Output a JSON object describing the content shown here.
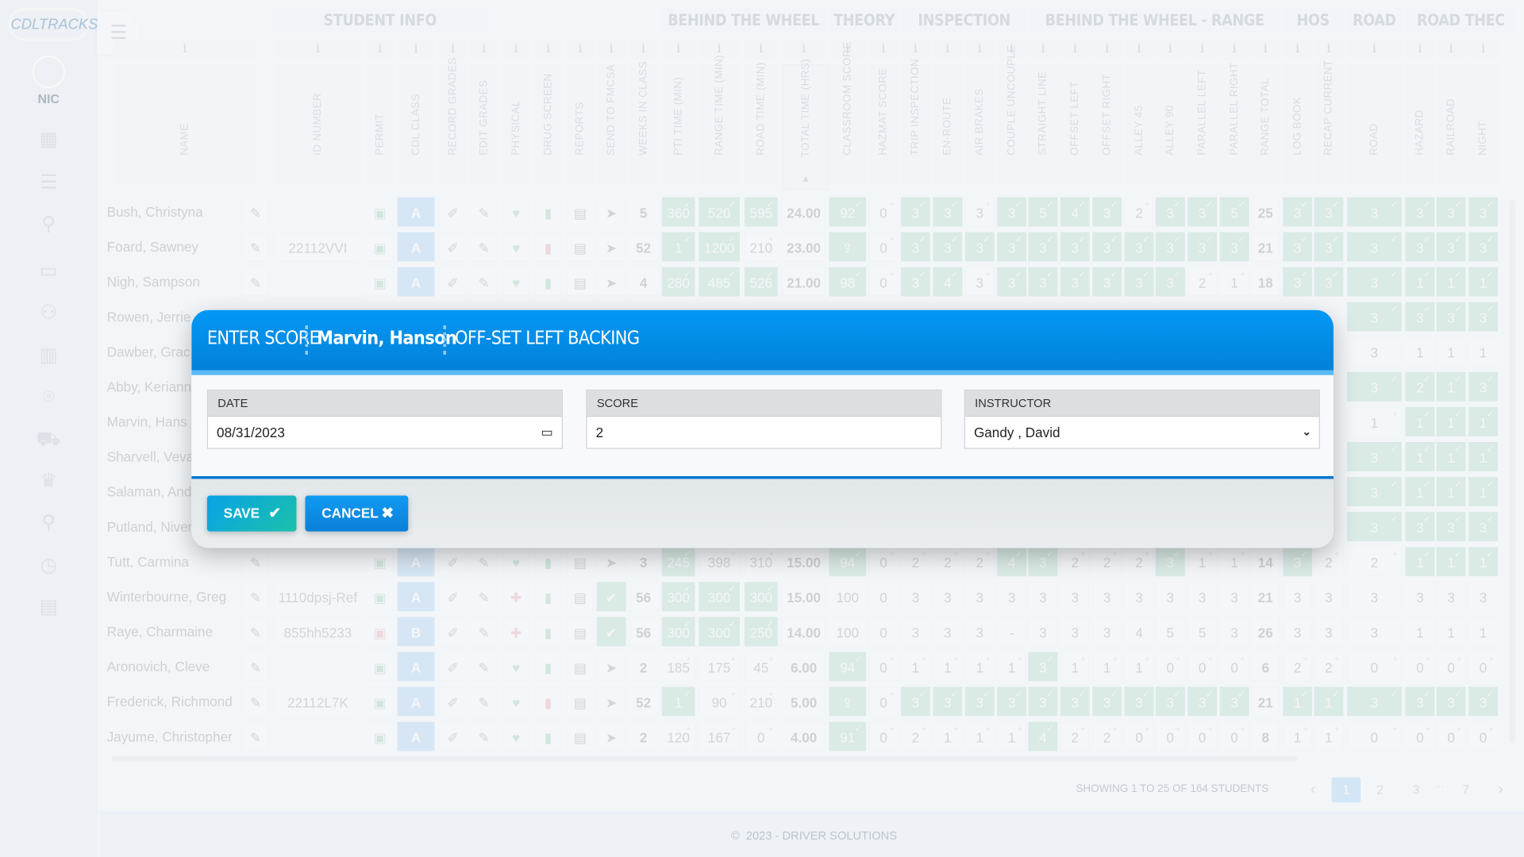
{
  "sidebar": {
    "logo": "CDLTRACKS",
    "user": "NIC",
    "icons": [
      "dashboard-grid-icon",
      "checklist-icon",
      "user-search-icon",
      "classroom-icon",
      "users-icon",
      "chart-icon",
      "location-icon",
      "truck-icon",
      "crown-icon",
      "instructor-icon",
      "clock-icon",
      "clipboard-icon"
    ]
  },
  "header": {
    "groups": [
      "STUDENT INFO",
      "BEHIND THE WHEEL",
      "THEORY",
      "INSPECTION",
      "BEHIND THE WHEEL - RANGE",
      "HOS",
      "ROAD",
      "ROAD THEC"
    ],
    "info_glyph": "i",
    "columns": [
      "NAME",
      "ID NUMBER",
      "PERMIT",
      "CDL CLASS",
      "RECORD GRADES",
      "EDIT GRADES",
      "PHYSICAL",
      "DRUG SCREEN",
      "REPORTS",
      "SEND TO FMCSA",
      "WEEKS IN CLASS",
      "PTI TIME (MIN)",
      "RANGE TIME (MIN)",
      "ROAD TIME (MIN)",
      "TOTAL TIME (HRS)",
      "CLASSROOM SCORE",
      "HAZMAT SCORE",
      "TRIP INSPECTION",
      "EN-ROUTE",
      "AIR BRAKES",
      "COUPLE UNCOUPLE",
      "STRAIGHT LINE",
      "OFFSET LEFT",
      "OFFSET RIGHT",
      "ALLEY 45",
      "ALLEY 90",
      "PARALLEL LEFT",
      "PARALLEL RIGHT",
      "RANGE TOTAL",
      "LOG BOOK",
      "RECAP CURRENT",
      "ROAD",
      "HAZARD",
      "RAILROAD",
      "NIGHT"
    ],
    "sort_indicator": "▲"
  },
  "rows": [
    {
      "name": "Bush, Christyna",
      "id": "",
      "cls": "A",
      "fmcsa": "send",
      "weeks": "5",
      "drug": "ok",
      "times": [
        "360✓",
        "520✓",
        "595✓"
      ],
      "total": "24.00",
      "classroom": "92✓",
      "hazmat": "0+",
      "scores": [
        "3✓",
        "3✓",
        "3+",
        "3✓",
        "5✓",
        "4✓",
        "3✓",
        "2+",
        "3✓",
        "3✓",
        "5✓"
      ],
      "range_total": "25",
      "road": [
        "3✓",
        "3✓",
        "3✓",
        "3✓",
        "3✓",
        "3✓"
      ]
    },
    {
      "name": "Foard, Sawney",
      "id": "22112VVI",
      "cls": "A",
      "fmcsa": "send",
      "weeks": "52",
      "drug": "fail",
      "times": [
        "1✓",
        "1200✓",
        "210+"
      ],
      "total": "23.00",
      "classroom": "upload",
      "hazmat": "0+",
      "scores": [
        "3✓",
        "3✓",
        "3✓",
        "3✓",
        "3✓",
        "3✓",
        "3✓",
        "3✓",
        "3✓",
        "3✓",
        "3✓"
      ],
      "range_total": "21",
      "road": [
        "3✓",
        "3✓",
        "3✓",
        "3✓",
        "3✓",
        "3✓"
      ]
    },
    {
      "name": "Nigh, Sampson",
      "id": "",
      "cls": "A",
      "fmcsa": "send",
      "weeks": "4",
      "drug": "ok",
      "times": [
        "280✓",
        "485✓",
        "526✓"
      ],
      "total": "21.00",
      "classroom": "98✓",
      "hazmat": "0+",
      "scores": [
        "3✓",
        "4✓",
        "3+",
        "3✓",
        "3✓",
        "3✓",
        "3✓",
        "3✓",
        "3✓",
        "2+",
        "1+"
      ],
      "range_total": "18",
      "road": [
        "3✓",
        "3✓",
        "3✓",
        "1✓",
        "1✓",
        "1✓"
      ]
    },
    {
      "name": "Rowen, Jerrie",
      "partial": true,
      "road": [
        "",
        "",
        "3✓",
        "3✓",
        "3✓",
        "3✓"
      ]
    },
    {
      "name": "Dawber, Grac",
      "partial": true,
      "road": [
        "",
        "",
        "3",
        "1",
        "1",
        "1"
      ]
    },
    {
      "name": "Abby, Keriann",
      "partial": true,
      "road": [
        "",
        "",
        "3✓",
        "2✓",
        "1✓",
        "3✓"
      ]
    },
    {
      "name": "Marvin, Hans",
      "partial": true,
      "road": [
        "",
        "",
        "1+",
        "1✓",
        "1✓",
        "1✓"
      ]
    },
    {
      "name": "Sharvell, Veva",
      "partial": true,
      "road": [
        "",
        "",
        "3✓",
        "1✓",
        "1✓",
        "1✓"
      ]
    },
    {
      "name": "Salaman, And",
      "partial": true,
      "road": [
        "",
        "",
        "3✓",
        "1✓",
        "1✓",
        "1✓"
      ]
    },
    {
      "name": "Putland, Niver",
      "partial": true,
      "road": [
        "",
        "",
        "3✓",
        "3✓",
        "3✓",
        "3✓"
      ]
    },
    {
      "name": "Tutt, Carmina",
      "id": "",
      "cls": "A",
      "fmcsa": "send",
      "weeks": "3",
      "drug": "ok",
      "times": [
        "245✓",
        "398+",
        "310+"
      ],
      "total": "15.00",
      "classroom": "94✓",
      "hazmat": "0+",
      "scores": [
        "2+",
        "2+",
        "2+",
        "4✓",
        "3✓",
        "2+",
        "2+",
        "2+",
        "3✓",
        "1+",
        "1+"
      ],
      "range_total": "14",
      "road": [
        "3✓",
        "2+",
        "2+",
        "1✓",
        "1✓",
        "1✓"
      ]
    },
    {
      "name": "Winterbourne, Greg",
      "id": "1110dpsj-Ref",
      "cls": "A",
      "fmcsa": "check",
      "weeks": "56",
      "drug": "ok",
      "phys": "fail",
      "times": [
        "300✓",
        "300✓",
        "300✓"
      ],
      "total": "15.00",
      "classroom": "100",
      "hazmat": "0",
      "scores": [
        "3",
        "3",
        "3",
        "3",
        "3",
        "3",
        "3",
        "3",
        "3",
        "3",
        "3"
      ],
      "range_total": "21",
      "road": [
        "3",
        "3",
        "3",
        "3",
        "3",
        "3"
      ]
    },
    {
      "name": "Raye, Charmaine",
      "id": "855hh5233",
      "cls": "B",
      "fmcsa": "check",
      "weeks": "56",
      "drug": "ok",
      "phys": "fail",
      "permit": "fail",
      "times": [
        "300✓",
        "300✓",
        "250✓"
      ],
      "total": "14.00",
      "classroom": "100",
      "hazmat": "0",
      "scores": [
        "3",
        "3",
        "3",
        "-",
        "3",
        "3",
        "3",
        "4",
        "5",
        "5",
        "3"
      ],
      "range_total": "26",
      "road": [
        "3",
        "3",
        "3",
        "1",
        "1",
        "1"
      ]
    },
    {
      "name": "Aronovich, Cleve",
      "id": "",
      "cls": "A",
      "fmcsa": "send",
      "weeks": "2",
      "drug": "ok",
      "times": [
        "185+",
        "175+",
        "45+"
      ],
      "total": "6.00",
      "classroom": "94✓",
      "hazmat": "0+",
      "scores": [
        "1+",
        "1+",
        "1+",
        "1+",
        "3✓",
        "1+",
        "1+",
        "1+",
        "0+",
        "0+",
        "0+"
      ],
      "range_total": "6",
      "road": [
        "2+",
        "2+",
        "0+",
        "0+",
        "0+",
        "0+"
      ]
    },
    {
      "name": "Frederick, Richmond",
      "id": "22112L7K",
      "cls": "A",
      "fmcsa": "send",
      "weeks": "52",
      "drug": "fail",
      "times": [
        "1✓",
        "90+",
        "210+"
      ],
      "total": "5.00",
      "classroom": "upload",
      "hazmat": "0+",
      "scores": [
        "3✓",
        "3✓",
        "3✓",
        "3✓",
        "3✓",
        "3✓",
        "3✓",
        "3✓",
        "3✓",
        "3✓",
        "3✓"
      ],
      "range_total": "21",
      "road": [
        "1✓",
        "1✓",
        "3✓",
        "3✓",
        "3✓",
        "3✓"
      ]
    },
    {
      "name": "Jayume, Christopher",
      "id": "",
      "cls": "A",
      "fmcsa": "send",
      "weeks": "2",
      "drug": "ok",
      "times": [
        "120+",
        "167+",
        "0+"
      ],
      "total": "4.00",
      "classroom": "91✓",
      "hazmat": "0+",
      "scores": [
        "2+",
        "1+",
        "1+",
        "1+",
        "4✓",
        "2+",
        "2+",
        "0+",
        "0+",
        "0+",
        "0+"
      ],
      "range_total": "8",
      "road": [
        "1+",
        "1+",
        "0+",
        "0+",
        "0+",
        "0+"
      ]
    }
  ],
  "pagination": {
    "summary": "SHOWING 1 TO 25 OF 164 STUDENTS",
    "prev": "‹",
    "pages": [
      "1",
      "2",
      "3"
    ],
    "ellipsis": "···",
    "last": "7",
    "next": "›",
    "current": "1"
  },
  "footer": {
    "copyright": "©  2023 - DRIVER SOLUTIONS"
  },
  "modal": {
    "title": "ENTER SCORE",
    "student": "Marvin, Hanson",
    "task": "OFF-SET LEFT BACKING",
    "date_label": "DATE",
    "date_value": "08/31/2023",
    "score_label": "SCORE",
    "score_value": "2",
    "instructor_label": "INSTRUCTOR",
    "instructor_value": "Gandy , David",
    "save_label": "SAVE",
    "cancel_label": "CANCEL"
  },
  "colors": {
    "modal_header": "#0398f6",
    "pass": "#7cc49a",
    "cdl_class": "#6fb1e6",
    "save": "#12b8c0",
    "cancel": "#0a86e0"
  }
}
